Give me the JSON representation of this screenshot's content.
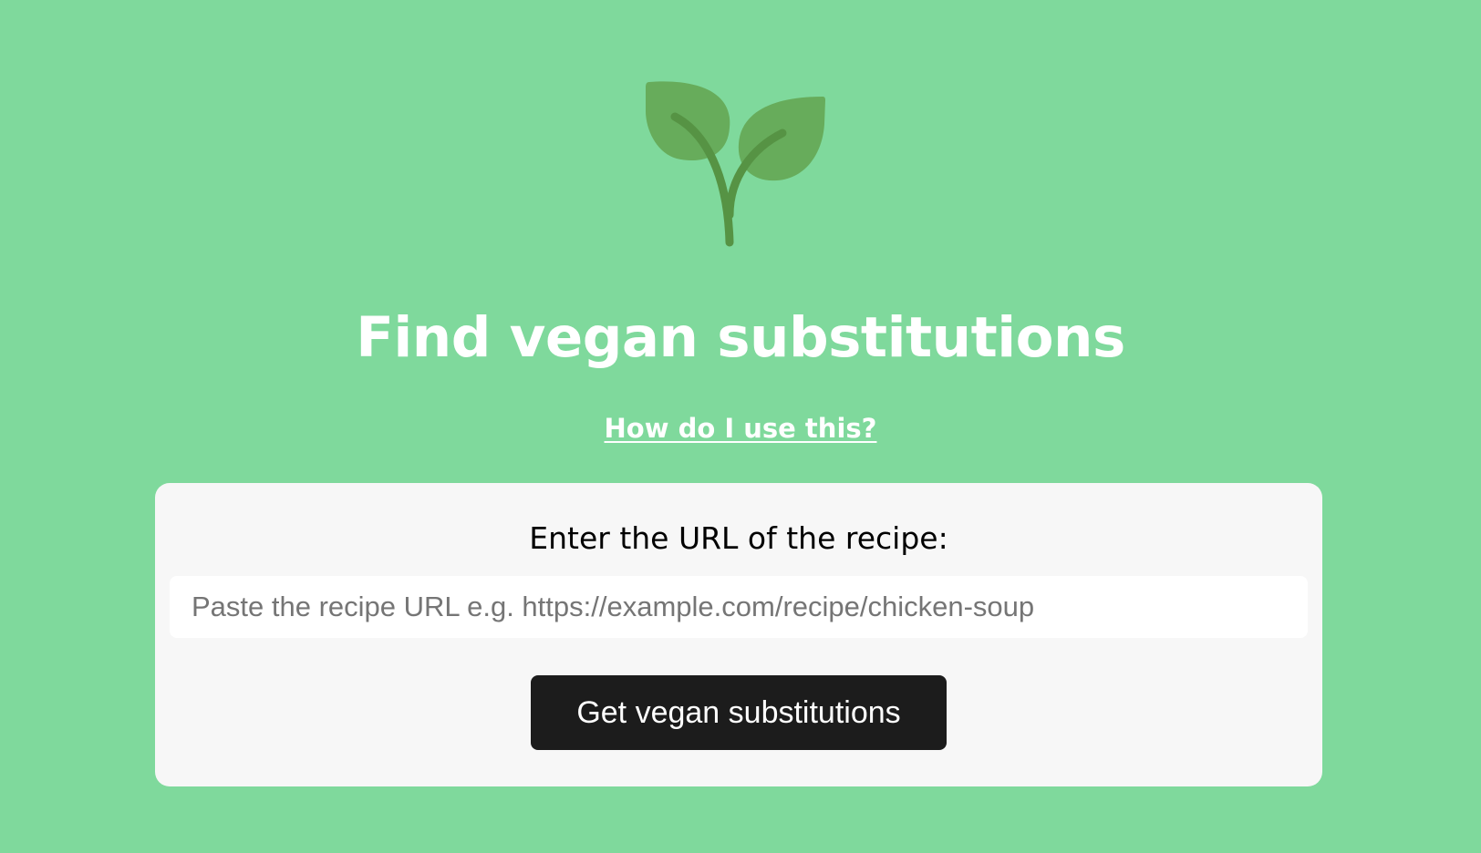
{
  "header": {
    "logo_icon": "sprout-icon",
    "title": "Find vegan substitutions",
    "help_link": "How do I use this?"
  },
  "form": {
    "label": "Enter the URL of the recipe:",
    "url_value": "",
    "url_placeholder": "Paste the recipe URL e.g. https://example.com/recipe/chicken-soup",
    "submit_label": "Get vegan substitutions"
  },
  "colors": {
    "background": "#7fd99c",
    "leaf": "#67ac5b",
    "stem": "#569344",
    "card": "#f7f7f7",
    "button": "#1c1c1c",
    "title_text": "#ffffff"
  }
}
